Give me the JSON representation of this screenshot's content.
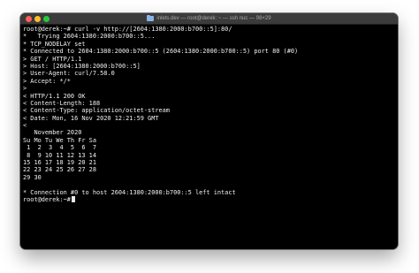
{
  "window": {
    "title": "inlets.dev — root@derek: ~ — ssh nuc — 98×29"
  },
  "terminal": {
    "lines": [
      "root@derek:~# curl -v http://[2604:1380:2000:b700::5]:80/",
      "*   Trying 2604:1380:2000:b700::5...",
      "* TCP_NODELAY set",
      "* Connected to 2604:1380:2000:b700::5 (2604:1380:2000:b700::5) port 80 (#0)",
      "> GET / HTTP/1.1",
      "> Host: [2604:1380:2000:b700::5]",
      "> User-Agent: curl/7.58.0",
      "> Accept: */*",
      ">",
      "< HTTP/1.1 200 OK",
      "< Content-Length: 188",
      "< Content-Type: application/octet-stream",
      "< Date: Mon, 16 Nov 2020 12:21:59 GMT",
      "<",
      "   November 2020",
      "Su Mo Tu We Th Fr Sa",
      " 1  2  3  4  5  6  7",
      " 8  9 10 11 12 13 14",
      "15 16 17 18 19 20 21",
      "22 23 24 25 26 27 28",
      "29 30",
      "",
      "* Connection #0 to host 2604:1380:2000:b700::5 left intact"
    ],
    "prompt": "root@derek:~#"
  }
}
